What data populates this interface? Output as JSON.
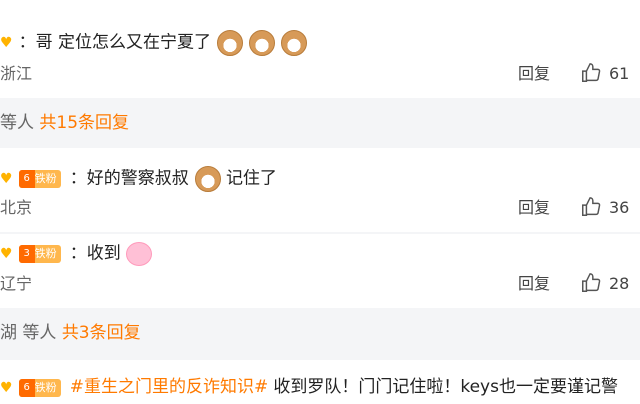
{
  "comments": [
    {
      "text": "：哥 定位怎么又在宁夏了",
      "location": "浙江",
      "reply_label": "回复",
      "likes": "61"
    },
    {
      "badge": "铁粉",
      "badge_level": "6",
      "text_before": "：好的警察叔叔",
      "text_after": "记住了",
      "location": "北京",
      "reply_label": "回复",
      "likes": "36"
    },
    {
      "badge": "铁粉",
      "badge_level": "3",
      "text": "：收到",
      "location": "辽宁",
      "reply_label": "回复",
      "likes": "28"
    },
    {
      "badge": "铁粉",
      "badge_level": "6",
      "hashtag": "#重生之门里的反诈知识#",
      "text": " 收到罗队！门门记住啦！keys也一定要谨记警"
    }
  ],
  "reply_summaries": [
    {
      "prefix": "等人",
      "link": "共15条回复"
    },
    {
      "prefix": "湖 等人",
      "link": "共3条回复"
    }
  ],
  "icons": {
    "like": "thumbs-up-icon",
    "emoji_cat": "cat-face-emoji-icon",
    "emoji_pig": "pig-face-emoji-icon",
    "heart": "heart-icon"
  },
  "colors": {
    "accent": "#ff7a00",
    "separator": "#f4f5f7",
    "text": "#222222",
    "meta": "#666666"
  }
}
